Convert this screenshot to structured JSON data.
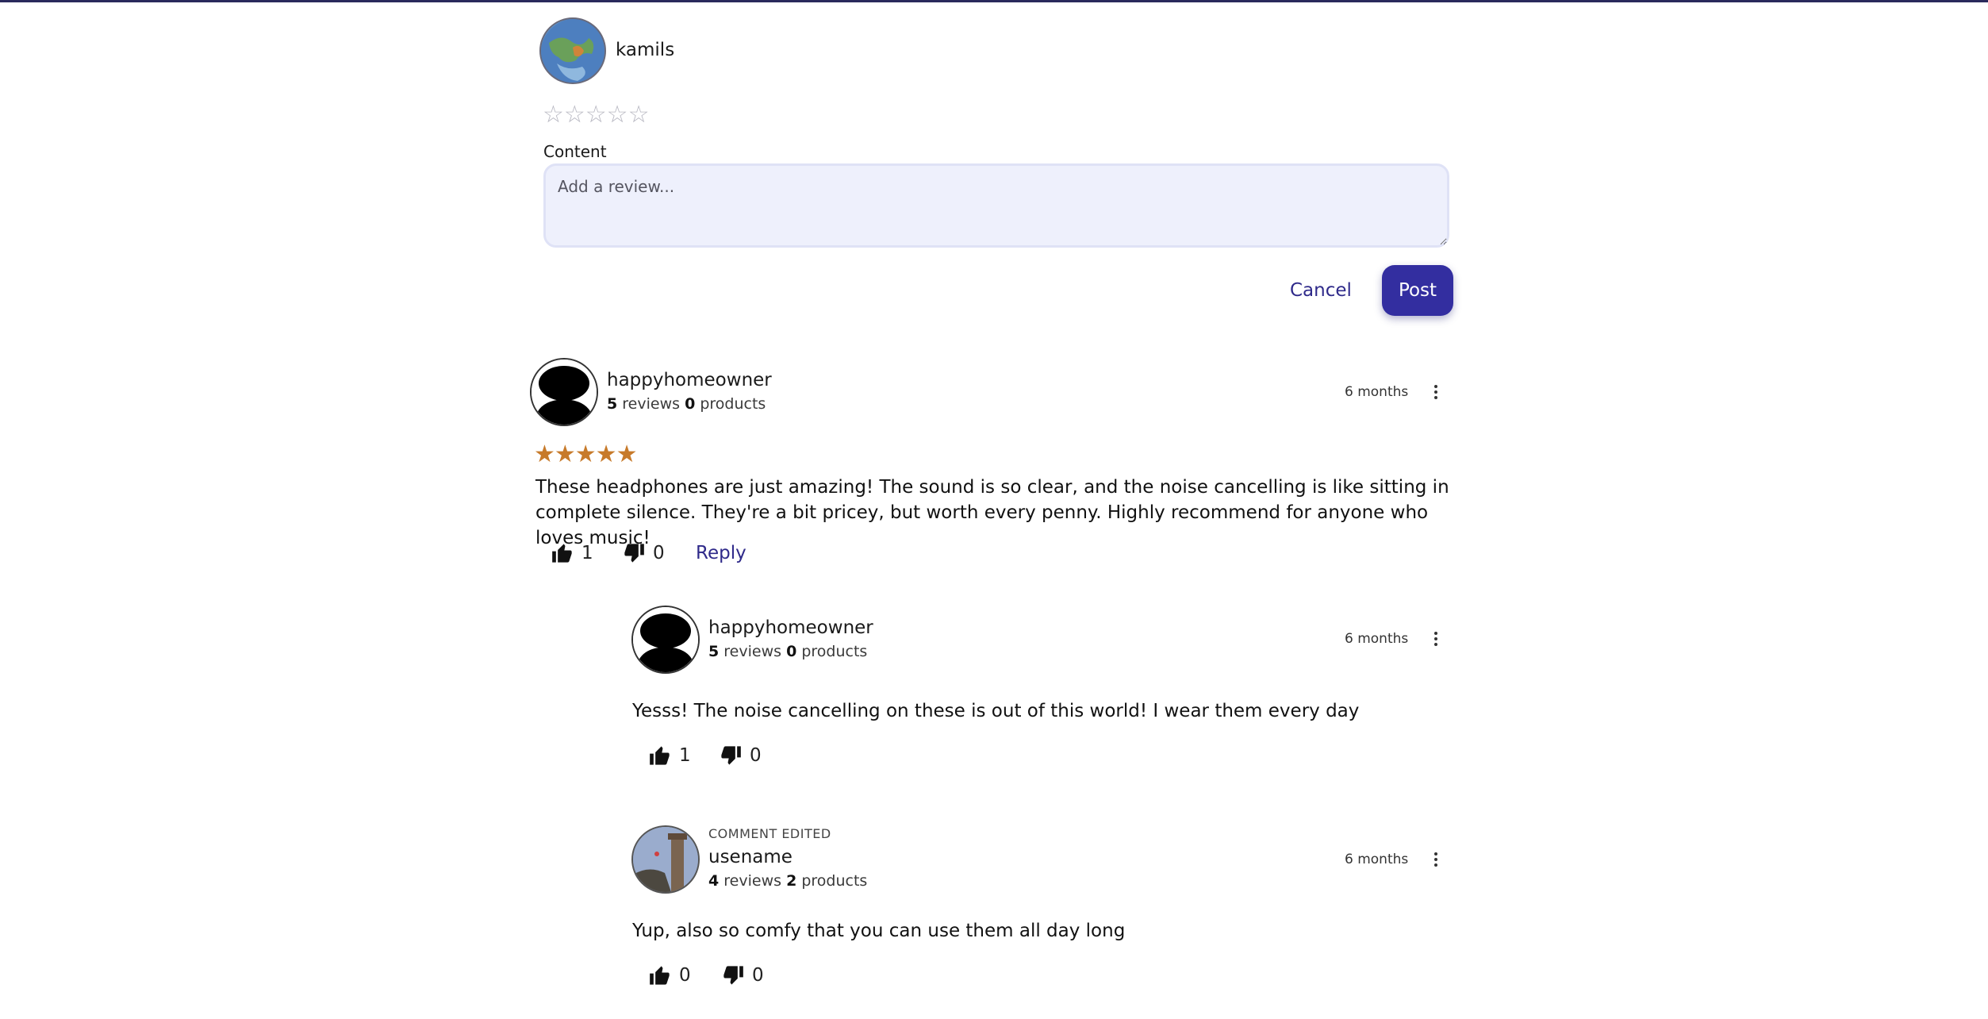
{
  "composer": {
    "username": "kamils",
    "rating_glyphs": "☆☆☆☆☆",
    "content_label": "Content",
    "placeholder": "Add a review...",
    "cancel_label": "Cancel",
    "post_label": "Post"
  },
  "comments": [
    {
      "username": "happyhomeowner",
      "reviews_count": "5",
      "reviews_label": "reviews",
      "products_count": "0",
      "products_label": "products",
      "time": "6 months",
      "rating": 5,
      "rating_glyphs": "★★★★★",
      "body": "These headphones are just amazing! The sound is so clear, and the noise cancelling is like sitting in complete silence. They're a bit pricey, but worth every penny. Highly recommend for anyone who loves music!",
      "likes": "1",
      "dislikes": "0",
      "reply_label": "Reply",
      "replies": [
        {
          "username": "happyhomeowner",
          "reviews_count": "5",
          "reviews_label": "reviews",
          "products_count": "0",
          "products_label": "products",
          "time": "6 months",
          "body": "Yesss! The noise cancelling on these is out of this world! I wear them every day",
          "likes": "1",
          "dislikes": "0"
        },
        {
          "edited_label": "COMMENT EDITED",
          "username": "usename",
          "reviews_count": "4",
          "reviews_label": "reviews",
          "products_count": "2",
          "products_label": "products",
          "time": "6 months",
          "body": "Yup, also so comfy that you can use them all day long",
          "likes": "0",
          "dislikes": "0"
        }
      ]
    }
  ],
  "colors": {
    "accent": "#332ea0",
    "link": "#2f2a8a",
    "star": "#c77a2a",
    "input_bg": "#eef0fc"
  },
  "icons": [
    "thumbs-up-icon",
    "thumbs-down-icon",
    "kebab-menu-icon",
    "star-icon"
  ]
}
